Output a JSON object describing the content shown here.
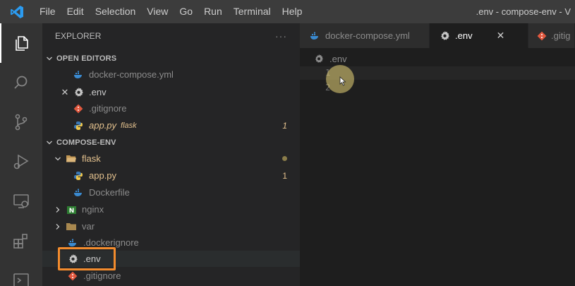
{
  "titlebar": {
    "menu": [
      "File",
      "Edit",
      "Selection",
      "View",
      "Go",
      "Run",
      "Terminal",
      "Help"
    ],
    "window_title": ".env - compose-env - V"
  },
  "activity_bar": {
    "icons": [
      "explorer-icon",
      "search-icon",
      "source-control-icon",
      "run-debug-icon",
      "remote-explorer-icon",
      "extensions-icon",
      "terminal-icon"
    ]
  },
  "sidebar": {
    "header": "EXPLORER",
    "more": "···",
    "open_editors_label": "OPEN EDITORS",
    "open_editors": [
      {
        "name": "docker-compose.yml",
        "icon": "docker-icon",
        "dim": true
      },
      {
        "name": ".env",
        "icon": "gear-icon",
        "active": true
      },
      {
        "name": ".gitignore",
        "icon": "git-icon",
        "dim": true
      },
      {
        "name": "app.py",
        "icon": "python-icon",
        "hint": "flask",
        "badge": "1",
        "modified_color": "#e2c08d"
      }
    ],
    "folder_label": "COMPOSE-ENV",
    "tree": [
      {
        "name": "flask",
        "type": "folder",
        "expanded": true
      },
      {
        "name": "app.py",
        "type": "file",
        "badge": "1"
      },
      {
        "name": "Dockerfile",
        "type": "file",
        "dim": true
      },
      {
        "name": "nginx",
        "type": "folder",
        "expanded": false
      },
      {
        "name": "var",
        "type": "folder",
        "expanded": false
      },
      {
        "name": ".dockerignore",
        "type": "file",
        "dim": true
      },
      {
        "name": ".env",
        "type": "file"
      },
      {
        "name": ".gitignore",
        "type": "file",
        "dim": true
      }
    ]
  },
  "editor": {
    "tabs": [
      {
        "name": "docker-compose.yml"
      },
      {
        "name": ".env",
        "active": true,
        "close": "✕"
      },
      {
        "name": ".gitig"
      }
    ],
    "breadcrumb": ".env",
    "line_numbers": [
      "1",
      "2"
    ]
  },
  "colors": {
    "accent_highlight": "#f28b2d",
    "modified": "#e2c08d"
  }
}
